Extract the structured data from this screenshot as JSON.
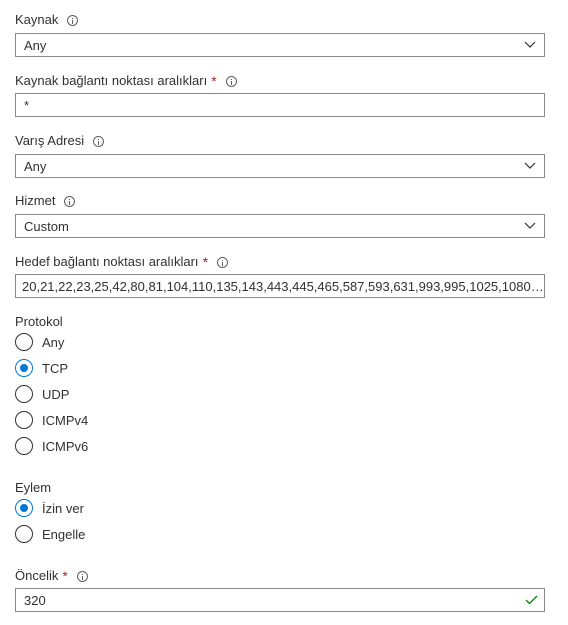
{
  "source": {
    "label": "Kaynak",
    "value": "Any"
  },
  "source_port": {
    "label": "Kaynak bağlantı noktası aralıkları",
    "required_mark": "*",
    "value": "*"
  },
  "destination": {
    "label": "Varış Adresi",
    "value": "Any"
  },
  "service": {
    "label": "Hizmet",
    "value": "Custom"
  },
  "destination_port": {
    "label": "Hedef bağlantı noktası aralıkları",
    "required_mark": "*",
    "value": "20,21,22,23,25,42,80,81,104,110,135,143,443,445,465,587,593,631,993,995,1025,1080,14..."
  },
  "protocol": {
    "label": "Protokol",
    "options": [
      "Any",
      "TCP",
      "UDP",
      "ICMPv4",
      "ICMPv6"
    ],
    "selected": "TCP"
  },
  "action": {
    "label": "Eylem",
    "options": [
      "İzin ver",
      "Engelle"
    ],
    "selected": "İzin ver"
  },
  "priority": {
    "label": "Öncelik",
    "required_mark": "*",
    "value": "320"
  },
  "colors": {
    "accent": "#0078d4",
    "required": "#a4262c",
    "valid": "#107c10",
    "border": "#8a8886"
  }
}
